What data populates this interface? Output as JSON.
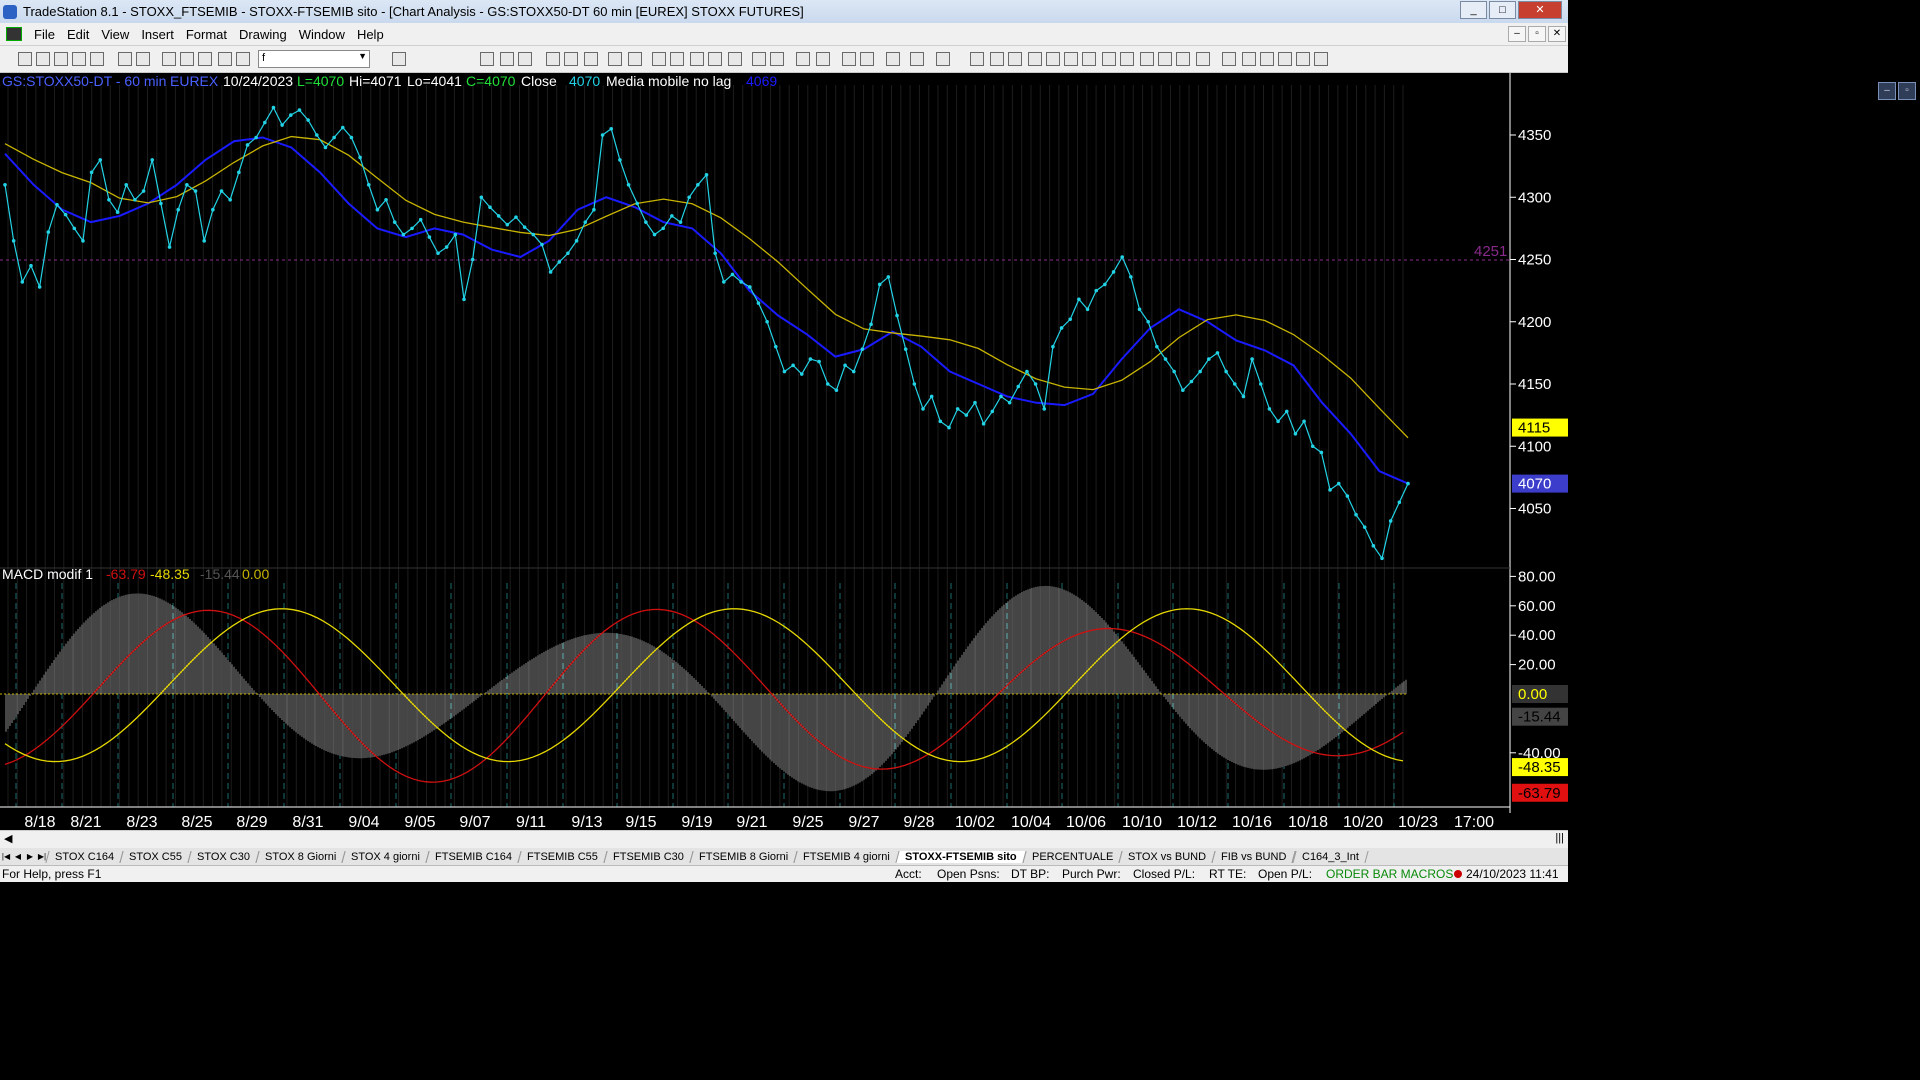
{
  "window": {
    "title": "TradeStation 8.1 - STOXX_FTSEMIB - STOXX-FTSEMIB sito - [Chart Analysis - GS:STOXX50-DT  60 min  [EUREX] STOXX FUTURES]",
    "buttons": [
      "_",
      "□",
      "✕"
    ]
  },
  "menu": [
    "File",
    "Edit",
    "View",
    "Insert",
    "Format",
    "Drawing",
    "Window",
    "Help"
  ],
  "mdi_buttons": [
    "–",
    "▫",
    "✕"
  ],
  "toolbar": {
    "dropdown_value": "f"
  },
  "chart_header": {
    "symbol": "GS:STOXX50-DT - 60 min",
    "exchange": "EUREX",
    "date": "10/24/2023",
    "last": "L=4070",
    "hi": "Hi=4071",
    "lo": "Lo=4041",
    "close_val": "C=4070",
    "close_label": "Close",
    "close_value": "4070",
    "ma_name": "Media mobile no lag",
    "ma_value": "4069"
  },
  "macd_header": {
    "name": "MACD modif 1",
    "v1": "-63.79",
    "v2": "-48.35",
    "v3": "-15.44",
    "v4": "0.00"
  },
  "price_axis": {
    "ticks": [
      "4350",
      "4300",
      "4250",
      "4200",
      "4150",
      "4100",
      "4050"
    ],
    "level_line_label": "4251",
    "markers": {
      "close": "4070",
      "level": "4115"
    }
  },
  "macd_axis": {
    "ticks": [
      "80.00",
      "60.00",
      "40.00",
      "20.00",
      "-40.00"
    ],
    "markers": {
      "zero": "0.00",
      "hist": "-15.44",
      "signal": "-48.35",
      "macd": "-63.79"
    }
  },
  "dates": [
    "8/18",
    "8/21",
    "8/23",
    "8/25",
    "8/29",
    "8/31",
    "9/04",
    "9/05",
    "9/07",
    "9/11",
    "9/13",
    "9/15",
    "9/19",
    "9/21",
    "9/25",
    "9/27",
    "9/28",
    "10/02",
    "10/04",
    "10/06",
    "10/10",
    "10/12",
    "10/16",
    "10/18",
    "10/20",
    "10/23",
    "17:00"
  ],
  "colors": {
    "price": "#22d3e6",
    "ma_fast": "#1a1aff",
    "ma_slow": "#c8b400",
    "macd": "#d01010",
    "signal": "#e6d800",
    "hist": "#8a8a8a",
    "level": "#8a2a8a"
  },
  "chart_data": {
    "type": "line",
    "title": "GS:STOXX50-DT - 60 min",
    "ylim": [
      4000,
      4380
    ],
    "series": [
      {
        "name": "Close",
        "values": [
          4310,
          4265,
          4232,
          4245,
          4228,
          4272,
          4294,
          4286,
          4275,
          4265,
          4320,
          4330,
          4298,
          4288,
          4310,
          4298,
          4305,
          4330,
          4295,
          4260,
          4290,
          4310,
          4305,
          4265,
          4290,
          4305,
          4298,
          4320,
          4342,
          4348,
          4360,
          4372,
          4358,
          4366,
          4370,
          4362,
          4350,
          4340,
          4348,
          4356,
          4348,
          4332,
          4310,
          4290,
          4298,
          4280,
          4270,
          4275,
          4282,
          4268,
          4255,
          4260,
          4270,
          4218,
          4250,
          4300,
          4292,
          4285,
          4278,
          4284,
          4276,
          4270,
          4262,
          4240,
          4248,
          4255,
          4265,
          4280,
          4290,
          4350,
          4355,
          4330,
          4310,
          4295,
          4280,
          4270,
          4275,
          4285,
          4280,
          4300,
          4310,
          4318,
          4255,
          4232,
          4238,
          4232,
          4228,
          4215,
          4200,
          4180,
          4160,
          4165,
          4158,
          4170,
          4168,
          4150,
          4145,
          4165,
          4160,
          4178,
          4198,
          4230,
          4236,
          4205,
          4178,
          4150,
          4130,
          4140,
          4120,
          4115,
          4130,
          4125,
          4135,
          4118,
          4128,
          4140,
          4135,
          4148,
          4160,
          4150,
          4130,
          4180,
          4195,
          4202,
          4218,
          4210,
          4225,
          4230,
          4240,
          4252,
          4236,
          4210,
          4200,
          4180,
          4170,
          4160,
          4145,
          4152,
          4160,
          4170,
          4175,
          4160,
          4150,
          4140,
          4170,
          4150,
          4130,
          4120,
          4128,
          4110,
          4120,
          4100,
          4095,
          4065,
          4070,
          4060,
          4045,
          4035,
          4020,
          4010,
          4040,
          4055,
          4070
        ]
      },
      {
        "name": "Media mobile no lag",
        "values": [
          4335,
          4310,
          4290,
          4280,
          4285,
          4295,
          4310,
          4330,
          4345,
          4348,
          4340,
          4320,
          4295,
          4275,
          4268,
          4275,
          4270,
          4258,
          4252,
          4265,
          4290,
          4300,
          4292,
          4280,
          4275,
          4255,
          4225,
          4205,
          4190,
          4172,
          4178,
          4192,
          4180,
          4160,
          4150,
          4140,
          4135,
          4133,
          4142,
          4170,
          4195,
          4210,
          4200,
          4185,
          4177,
          4165,
          4135,
          4110,
          4080,
          4070
        ]
      }
    ]
  },
  "status": {
    "help": "For Help, press F1",
    "acct": "Acct:",
    "open_psns": "Open Psns:",
    "dt_bp": "DT BP:",
    "purch_pwr": "Purch Pwr:",
    "closed_pl": "Closed P/L:",
    "rt_te": "RT TE:",
    "open_pl": "Open P/L:",
    "macros": "ORDER BAR  MACROS",
    "datetime": "24/10/2023 11:41"
  },
  "tabs": [
    "STOX C164",
    "STOX C55",
    "STOX  C30",
    "STOX  8 Giorni",
    "STOX 4 giorni",
    "FTSEMIB C164",
    "FTSEMIB C55",
    "FTSEMIB C30",
    "FTSEMIB  8 Giorni",
    "FTSEMIB  4 giorni",
    "STOXX-FTSEMIB sito",
    "PERCENTUALE",
    "STOX vs BUND",
    "FIB vs BUND",
    "C164_3_Int"
  ],
  "active_tab": "STOXX-FTSEMIB sito"
}
